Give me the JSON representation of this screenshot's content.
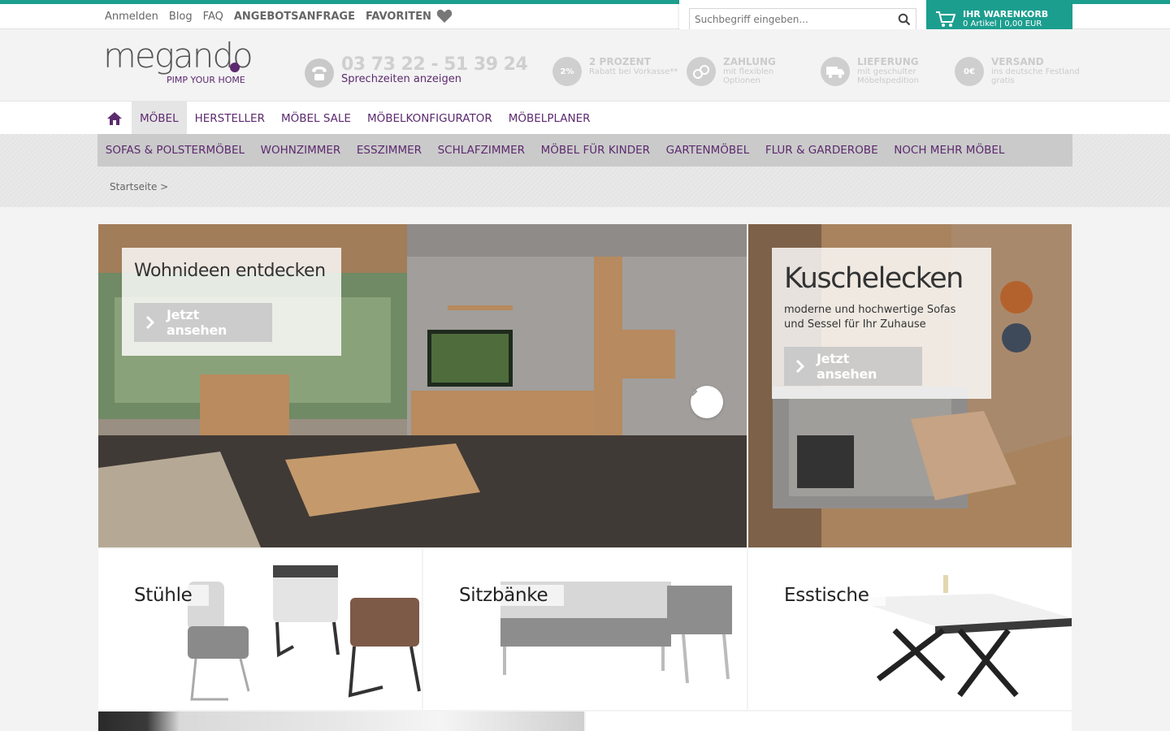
{
  "topbar": {
    "links": [
      "Anmelden",
      "Blog",
      "FAQ"
    ],
    "quote_request": "ANGEBOTSANFRAGE",
    "favorites": "FAVORITEN"
  },
  "search": {
    "placeholder": "Suchbegriff eingeben..."
  },
  "cart": {
    "title": "IHR WARENKORB",
    "summary": "0 Artikel | 0,00 EUR"
  },
  "logo": {
    "word": "megando",
    "tagline": "PIMP YOUR HOME"
  },
  "phone": {
    "number": "03 73 22 - 51 39 24",
    "hours_link": "Sprechzeiten anzeigen"
  },
  "usps": [
    {
      "badge": "2%",
      "title": "2 PROZENT",
      "text": "Rabatt bei Vorkasse**"
    },
    {
      "badge": "",
      "title": "ZAHLUNG",
      "text": "mit flexiblen Optionen"
    },
    {
      "badge": "",
      "title": "LIEFERUNG",
      "text": "mit geschulter Möbelspedition"
    },
    {
      "badge": "0€",
      "title": "VERSAND",
      "text": "ins deutsche Festland gratis"
    }
  ],
  "mainnav": [
    "MÖBEL",
    "HERSTELLER",
    "MÖBEL SALE",
    "MÖBELKONFIGURATOR",
    "MÖBELPLANER"
  ],
  "subnav": [
    "SOFAS & POLSTERMÖBEL",
    "WOHNZIMMER",
    "ESSZIMMER",
    "SCHLAFZIMMER",
    "MÖBEL FÜR KINDER",
    "GARTENMÖBEL",
    "FLUR & GARDEROBE",
    "NOCH MEHR MÖBEL"
  ],
  "breadcrumb": "Startseite >",
  "hero": {
    "left": {
      "title": "Wohnideen entdecken",
      "button": "Jetzt ansehen"
    },
    "right": {
      "title": "Kuschelecken",
      "text": "moderne und hochwertige Sofas und Sessel für Ihr Zuhause",
      "button": "Jetzt ansehen"
    }
  },
  "categories": [
    "Stühle",
    "Sitzbänke",
    "Esstische"
  ],
  "colors": {
    "accent": "#1c9e8f",
    "brand": "#5c2a6e"
  }
}
